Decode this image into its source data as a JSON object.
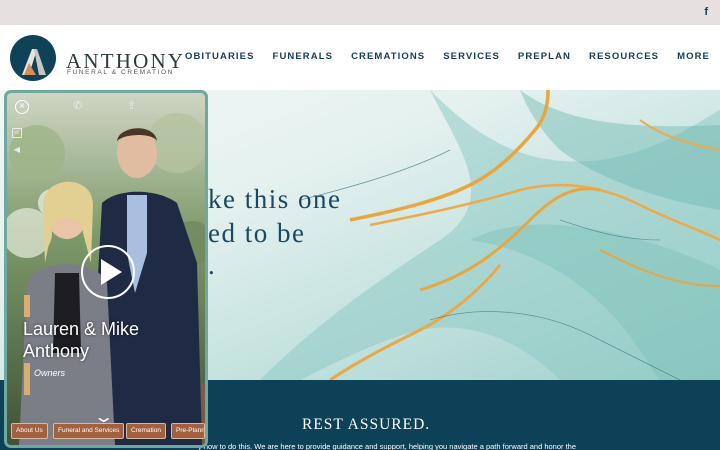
{
  "topbar": {
    "social_icon": "f"
  },
  "brand": {
    "name": "ANTHONY",
    "tagline": "FUNERAL & CREMATION"
  },
  "nav": {
    "items": [
      "OBITUARIES",
      "FUNERALS",
      "CREMATIONS",
      "SERVICES",
      "PREPLAN",
      "RESOURCES",
      "MORE"
    ]
  },
  "hero": {
    "line1": "ke this one",
    "line2": "ed to be",
    "line3": "."
  },
  "band": {
    "title": "REST ASSURED.",
    "text": "y how to do this. We are here to provide guidance and support, helping you navigate a path forward and honor the"
  },
  "video": {
    "close_glyph": "×",
    "person_line1": "Lauren & Mike",
    "person_line2": "Anthony",
    "role": "Owners",
    "pills": [
      "About Us",
      "Funeral and Services",
      "Cremation",
      "Pre-Planning"
    ]
  },
  "colors": {
    "brand_navy": "#0c4158",
    "accent_copper": "#a1603f",
    "panel_border": "#6fa8a0"
  }
}
